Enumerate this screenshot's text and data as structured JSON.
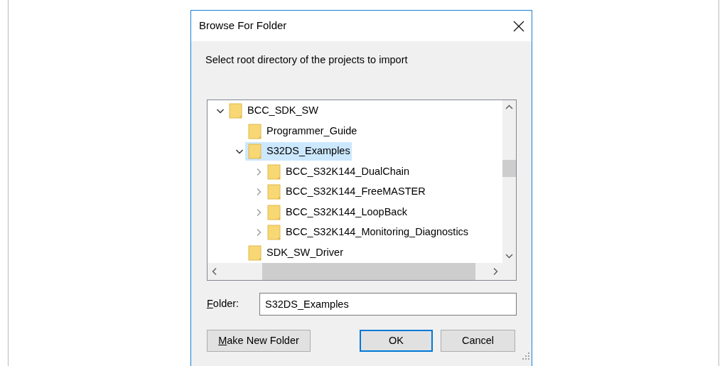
{
  "window": {
    "title": "Browse For Folder"
  },
  "prompt": "Select root directory of the projects to import",
  "tree": [
    {
      "label": "BCC_SDK_SW",
      "expanded": true,
      "selected": false,
      "children": [
        {
          "label": "Programmer_Guide",
          "selected": false
        },
        {
          "label": "S32DS_Examples",
          "expanded": true,
          "selected": true,
          "children": [
            {
              "label": "BCC_S32K144_DualChain",
              "expanded": false,
              "selected": false
            },
            {
              "label": "BCC_S32K144_FreeMASTER",
              "expanded": false,
              "selected": false
            },
            {
              "label": "BCC_S32K144_LoopBack",
              "expanded": false,
              "selected": false
            },
            {
              "label": "BCC_S32K144_Monitoring_Diagnostics",
              "expanded": false,
              "selected": false
            }
          ]
        },
        {
          "label": "SDK_SW_Driver",
          "selected": false
        }
      ]
    }
  ],
  "folder_field": {
    "label": "Folder:",
    "access_key_underlined": true,
    "value": "S32DS_Examples"
  },
  "buttons": [
    {
      "label": "Make New Folder",
      "access_key_underlined": true,
      "default": false
    },
    {
      "label": "OK",
      "default": true
    },
    {
      "label": "Cancel",
      "default": false
    }
  ]
}
